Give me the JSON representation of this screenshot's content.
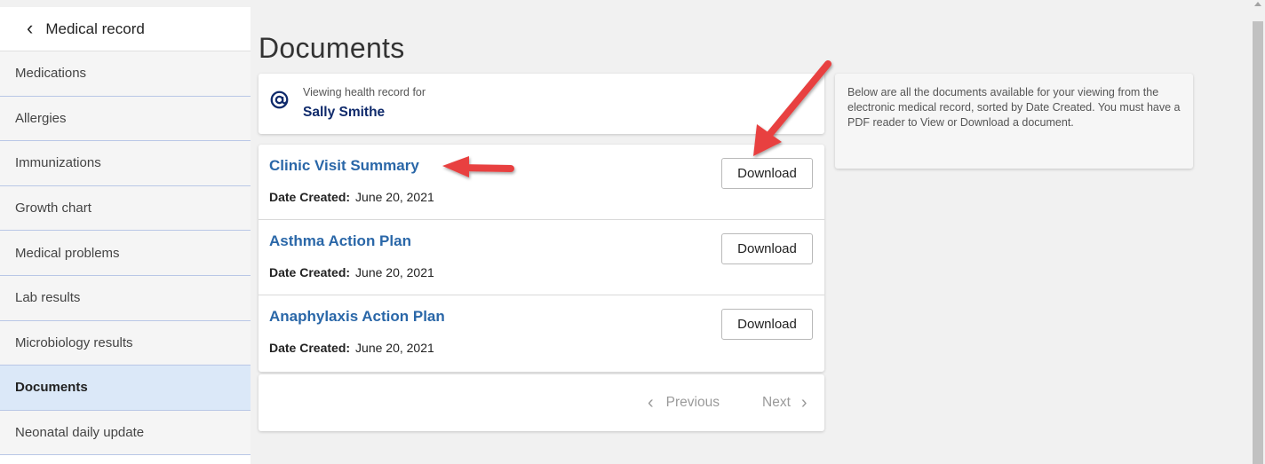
{
  "sidebar": {
    "back_label": "Medical record",
    "items": [
      {
        "label": "Medications"
      },
      {
        "label": "Allergies"
      },
      {
        "label": "Immunizations"
      },
      {
        "label": "Growth chart"
      },
      {
        "label": "Medical problems"
      },
      {
        "label": "Lab results"
      },
      {
        "label": "Microbiology results"
      },
      {
        "label": "Documents"
      },
      {
        "label": "Neonatal daily update"
      }
    ],
    "active_item": "Documents"
  },
  "page": {
    "title": "Documents"
  },
  "viewing": {
    "label": "Viewing health record for",
    "name": "Sally Smithe",
    "icon": "at-sign-icon"
  },
  "documents": [
    {
      "title": "Clinic Visit Summary",
      "date_label": "Date Created:",
      "date": "June 20, 2021",
      "button": "Download"
    },
    {
      "title": "Asthma Action Plan",
      "date_label": "Date Created:",
      "date": "June 20, 2021",
      "button": "Download"
    },
    {
      "title": "Anaphylaxis Action Plan",
      "date_label": "Date Created:",
      "date": "June 20, 2021",
      "button": "Download"
    }
  ],
  "pager": {
    "previous": "Previous",
    "next": "Next"
  },
  "info": {
    "text": "Below are all the documents available for your viewing from the electronic medical record, sorted by Date Created. You must have a PDF reader to View or Download a document."
  },
  "colors": {
    "link": "#2a67a8",
    "name": "#0f2a6b",
    "active_bg": "#dbe8f8",
    "annotation_arrow": "#e8403f"
  }
}
